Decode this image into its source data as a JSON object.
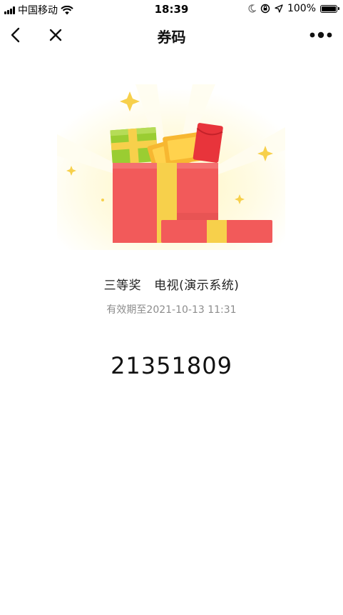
{
  "status_bar": {
    "carrier": "中国移动",
    "time": "18:39",
    "battery": "100%"
  },
  "nav": {
    "title": "券码"
  },
  "prize": {
    "level": "三等奖",
    "name": "电视(演示系统)",
    "expiry": "有效期至2021-10-13 11:31"
  },
  "coupon_code": "21351809",
  "colors": {
    "gift_red": "#f25a5a",
    "gift_yellow": "#f7d04b",
    "gift_green": "#9acd32",
    "expiry_gray": "#8c8c8c"
  }
}
